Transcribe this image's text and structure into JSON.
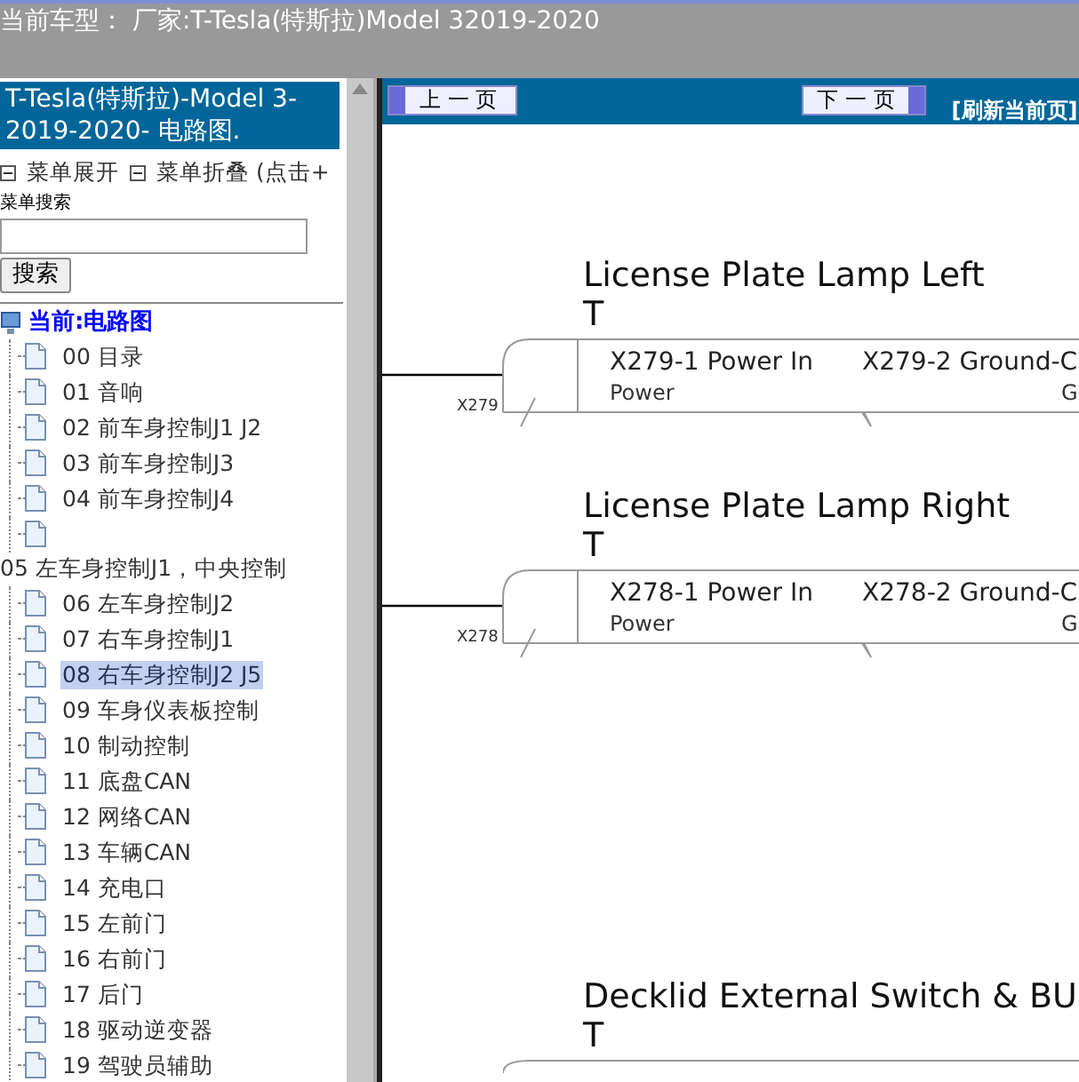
{
  "header": {
    "vehicle": "当前车型： 厂家:T-Tesla(特斯拉)Model 32019-2020"
  },
  "sidebar": {
    "title": "T-Tesla(特斯拉)-Model 3-2019-2020- 电路图.",
    "menu_expand": "菜单展开",
    "menu_collapse": "菜单折叠 (点击+",
    "search_label": "菜单搜索",
    "search_button": "搜索",
    "tree": {
      "label": "当前:电路图",
      "children": [
        {
          "kind": "page",
          "label": "00 目录",
          "selected": false
        },
        {
          "kind": "page",
          "label": "01 音响",
          "selected": false
        },
        {
          "kind": "page",
          "label": "02 前车身控制J1 J2",
          "selected": false
        },
        {
          "kind": "page",
          "label": "03 前车身控制J3",
          "selected": false
        },
        {
          "kind": "page",
          "label": "04 前车身控制J4",
          "selected": false
        },
        {
          "kind": "page",
          "selected": false
        },
        {
          "kind": "group",
          "label": "05 左车身控制J1，中央控制",
          "selected": false
        },
        {
          "kind": "page",
          "label": "06 左车身控制J2",
          "selected": false
        },
        {
          "kind": "page",
          "label": "07 右车身控制J1",
          "selected": false
        },
        {
          "kind": "page",
          "label": "08 右车身控制J2 J5",
          "selected": true
        },
        {
          "kind": "page",
          "label": "09 车身仪表板控制",
          "selected": false
        },
        {
          "kind": "page",
          "label": "10 制动控制",
          "selected": false
        },
        {
          "kind": "page",
          "label": "11 底盘CAN",
          "selected": false
        },
        {
          "kind": "page",
          "label": "12 网络CAN",
          "selected": false
        },
        {
          "kind": "page",
          "label": "13 车辆CAN",
          "selected": false
        },
        {
          "kind": "page",
          "label": "14 充电口",
          "selected": false
        },
        {
          "kind": "page",
          "label": "15 左前门",
          "selected": false
        },
        {
          "kind": "page",
          "label": "16 右前门",
          "selected": false
        },
        {
          "kind": "page",
          "label": "17 后门",
          "selected": false
        },
        {
          "kind": "page",
          "label": "18 驱动逆变器",
          "selected": false
        },
        {
          "kind": "page",
          "label": "19 驾驶员辅助",
          "selected": false
        }
      ]
    }
  },
  "toolbar": {
    "prev": "上 一 页",
    "next": "下 一 页",
    "refresh": "[刷新当前页]"
  },
  "diagrams": [
    {
      "title": "License Plate Lamp Left",
      "subtitle": "T",
      "connector": "X279",
      "pins": [
        {
          "name": "X279-1 Power In",
          "signal": "Power"
        },
        {
          "name": "X279-2 Ground-C",
          "signal": "G"
        }
      ]
    },
    {
      "title": "License Plate Lamp Right",
      "subtitle": "T",
      "connector": "X278",
      "pins": [
        {
          "name": "X278-1 Power In",
          "signal": "Power"
        },
        {
          "name": "X278-2 Ground-C",
          "signal": "G"
        }
      ]
    },
    {
      "title": "Decklid External Switch & BU",
      "subtitle": "T"
    }
  ]
}
